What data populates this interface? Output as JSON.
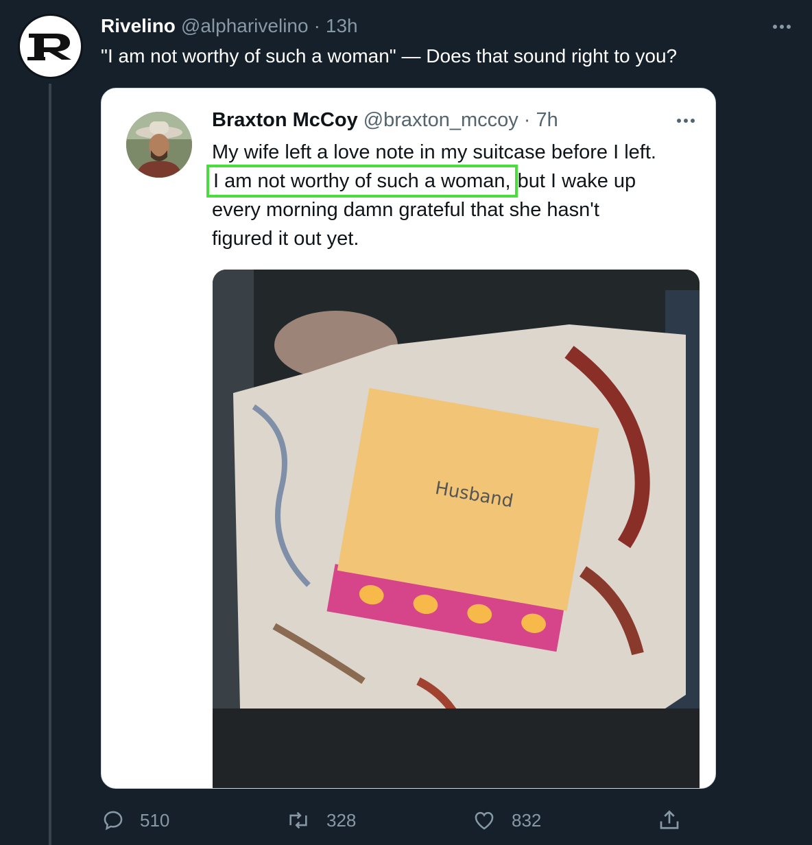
{
  "outer_tweet": {
    "name": "Rivelino",
    "handle": "@alpharivelino",
    "separator": "·",
    "time": "13h",
    "text": "\"I am not worthy of such a woman\" — Does that sound right to you?",
    "avatar_letter": "R",
    "avatar_icon": "rivelino-logo-icon",
    "more_icon": "more-horizontal-icon"
  },
  "quoted_tweet": {
    "name": "Braxton McCoy",
    "handle": "@braxton_mccoy",
    "separator": "·",
    "time": "7h",
    "text_line1": "My wife left a love note in my suitcase before I left.",
    "text_highlight": "I am not worthy of such a woman,",
    "text_line2_rest": " but I wake up",
    "text_line3": "every morning damn grateful that she hasn't",
    "text_line4": "figured it out yet.",
    "highlight_color": "#4ade3c",
    "photo": {
      "description_icon": "suitcase-photo",
      "envelope_text": "Husband"
    }
  },
  "actions": {
    "reply": {
      "icon": "reply-icon",
      "count": "510"
    },
    "retweet": {
      "icon": "retweet-icon",
      "count": "328"
    },
    "like": {
      "icon": "heart-icon",
      "count": "832"
    },
    "share": {
      "icon": "share-icon"
    }
  },
  "colors": {
    "background": "#15202b",
    "secondary_text": "#8899a6",
    "card_background": "#ffffff"
  }
}
